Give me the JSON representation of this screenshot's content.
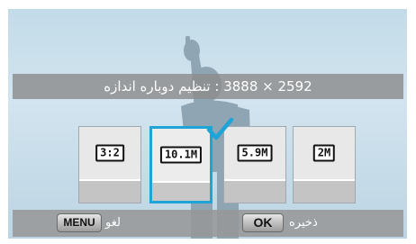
{
  "resize_title": "2592 × 3888 : تنظیم دوباره اندازه",
  "size_options": [
    {
      "icon_text": "3:2",
      "selected": false
    },
    {
      "icon_text": "10.1M",
      "selected": true
    },
    {
      "icon_text": "5.9M",
      "selected": false
    },
    {
      "icon_text": "2M",
      "selected": false
    }
  ],
  "footer": {
    "menu_key": "MENU",
    "cancel_label": "لغو",
    "ok_key": "OK",
    "save_label": "ذخیره"
  },
  "colors": {
    "accent": "#1ea4d6",
    "background": "#c8dde9"
  }
}
